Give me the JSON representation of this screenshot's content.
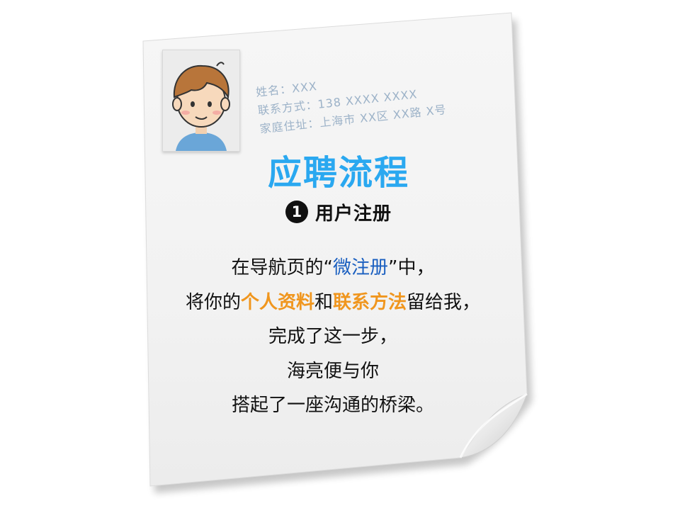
{
  "profile": {
    "name_line": "姓名：XXX",
    "contact_line": "联系方式：138 XXXX XXXX",
    "address_line": "家庭住址：上海市 XX区 XX路 X号"
  },
  "title": "应聘流程",
  "step": {
    "number": "1",
    "label": "用户注册"
  },
  "body": {
    "line1_pre": "在导航页的“",
    "line1_highlight": "微注册",
    "line1_post": "”中，",
    "line2_pre": "将你的",
    "line2_highlight1": "个人资料",
    "line2_mid": "和",
    "line2_highlight2": "联系方法",
    "line2_post": "留给我，",
    "line3": "完成了这一步，",
    "line4": "海亮便与你",
    "line5": "搭起了一座沟通的桥梁。"
  },
  "colors": {
    "title_blue": "#2aa8f0",
    "highlight_blue": "#1a5fc0",
    "highlight_orange": "#f0961e",
    "handwriting_gray_blue": "#9cb2c8"
  },
  "icons": {
    "avatar": "cartoon-boy-avatar-icon",
    "step_number": "filled-circle-number-icon"
  }
}
